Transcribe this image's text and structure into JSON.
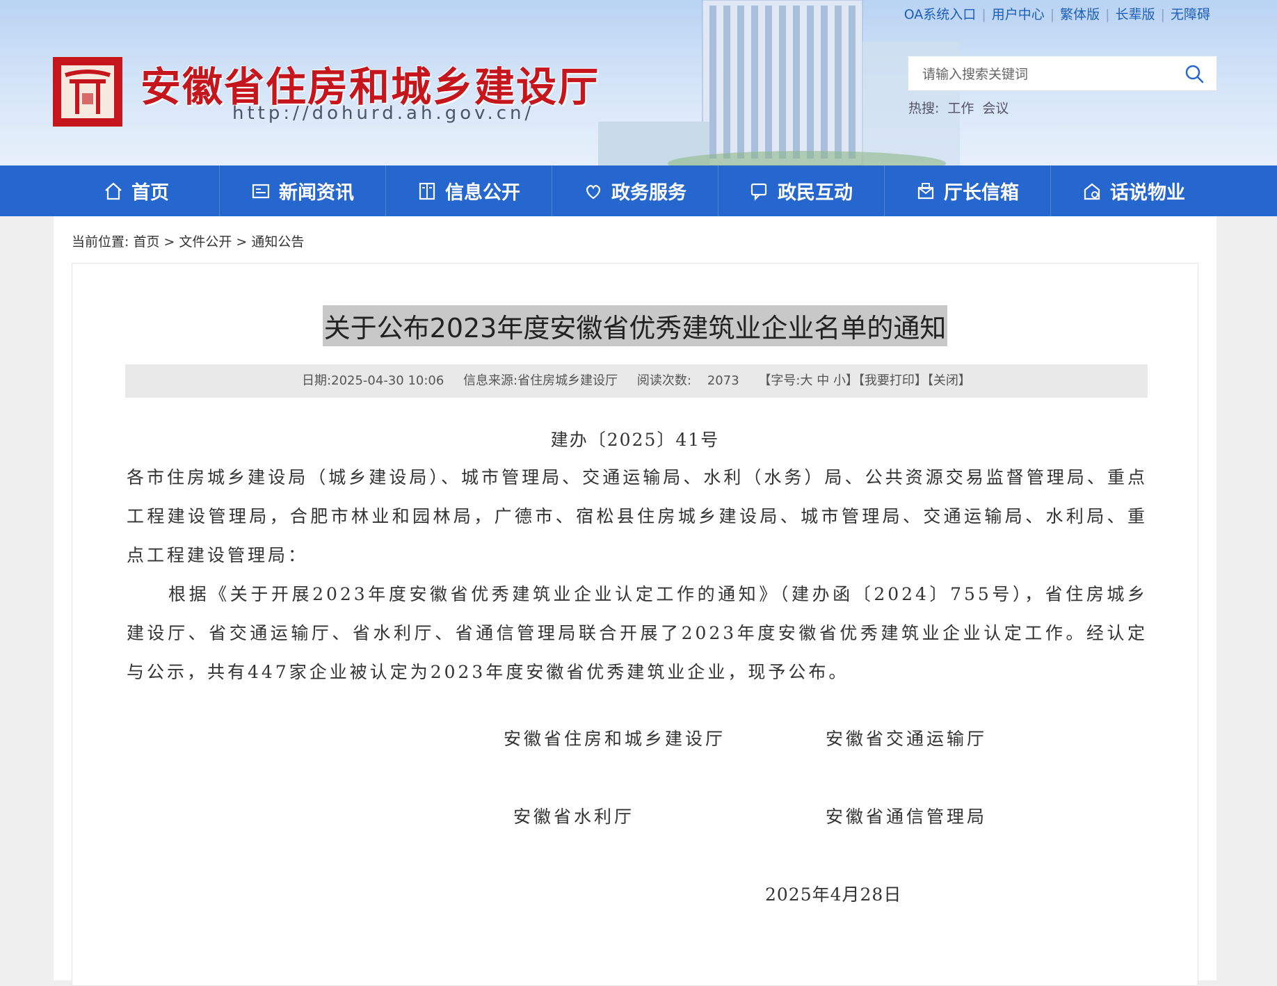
{
  "header": {
    "site_title": "安徽省住房和城乡建设厅",
    "site_url": "http://dohurd.ah.gov.cn/",
    "top_links": [
      "OA系统入口",
      "用户中心",
      "繁体版",
      "长辈版",
      "无障碍"
    ],
    "search": {
      "placeholder": "请输入搜索关键词"
    },
    "hot": {
      "label": "热搜:",
      "items": [
        "工作",
        "会议"
      ]
    }
  },
  "nav": {
    "items": [
      {
        "label": "首页",
        "icon": "home-icon"
      },
      {
        "label": "新闻资讯",
        "icon": "news-icon"
      },
      {
        "label": "信息公开",
        "icon": "book-icon"
      },
      {
        "label": "政务服务",
        "icon": "service-icon"
      },
      {
        "label": "政民互动",
        "icon": "chat-icon"
      },
      {
        "label": "厅长信箱",
        "icon": "mailbox-icon"
      },
      {
        "label": "话说物业",
        "icon": "property-icon"
      }
    ]
  },
  "breadcrumb": {
    "label": "当前位置:",
    "items": [
      "首页",
      "文件公开",
      "通知公告"
    ]
  },
  "article": {
    "title": "关于公布2023年度安徽省优秀建筑业企业名单的通知",
    "meta": {
      "date": "日期:2025-04-30 10:06",
      "source": "信息来源:省住房城乡建设厅",
      "views_label": "阅读次数:",
      "views": "2073",
      "font_label": "【字号:",
      "font_large": "大",
      "font_medium": "中",
      "font_small": "小】",
      "print": "【我要打印】",
      "close": "【关闭】"
    },
    "doc_number": "建办〔2025〕41号",
    "recipients": "各市住房城乡建设局（城乡建设局）、城市管理局、交通运输局、水利（水务）局、公共资源交易监督管理局、重点工程建设管理局，合肥市林业和园林局，广德市、宿松县住房城乡建设局、城市管理局、交通运输局、水利局、重点工程建设管理局：",
    "paragraph1": "根据《关于开展2023年度安徽省优秀建筑业企业认定工作的通知》（建办函〔2024〕755号），省住房城乡建设厅、省交通运输厅、省水利厅、省通信管理局联合开展了2023年度安徽省优秀建筑业企业认定工作。经认定与公示，共有447家企业被认定为2023年度安徽省优秀建筑业企业，现予公布。",
    "signatures": {
      "s1": "安徽省住房和城乡建设厅",
      "s2": "安徽省交通运输厅",
      "s3": "安徽省水利厅",
      "s4": "安徽省通信管理局"
    },
    "date_signed": "2025年4月28日"
  },
  "colors": {
    "brand_red": "#c4161c",
    "nav_blue": "#2667cf"
  }
}
